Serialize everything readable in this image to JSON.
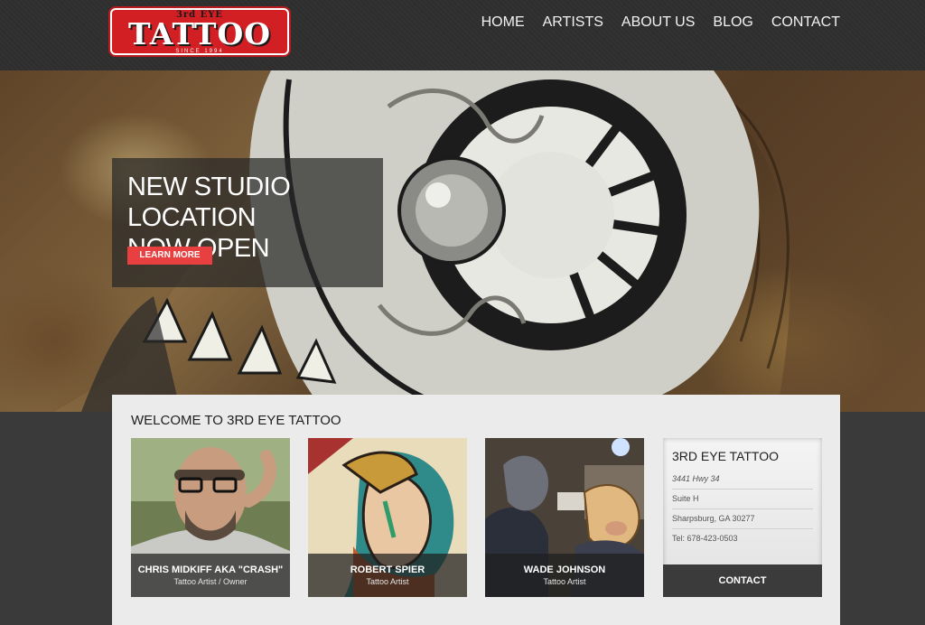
{
  "logo": {
    "top": "3rd EYE",
    "main": "TATTOO",
    "since": "SINCE 1994"
  },
  "nav": {
    "items": [
      {
        "label": "HOME"
      },
      {
        "label": "ARTISTS"
      },
      {
        "label": "ABOUT US"
      },
      {
        "label": "BLOG"
      },
      {
        "label": "CONTACT"
      }
    ]
  },
  "hero": {
    "title_line1": "NEW STUDIO LOCATION",
    "title_line2": "NOW OPEN",
    "button": "LEARN MORE"
  },
  "welcome": {
    "heading": "WELCOME TO 3RD EYE TATTOO"
  },
  "artists": [
    {
      "name": "CHRIS MIDKIFF AKA \"CRASH\"",
      "role": "Tattoo Artist / Owner"
    },
    {
      "name": "ROBERT SPIER",
      "role": "Tattoo Artist"
    },
    {
      "name": "WADE JOHNSON",
      "role": "Tattoo Artist"
    }
  ],
  "contact": {
    "title": "3RD EYE TATTOO",
    "address": "3441 Hwy 34",
    "suite": "Suite H",
    "city": "Sharpsburg, GA 30277",
    "phone": "Tel: 678-423-0503",
    "button": "CONTACT"
  },
  "colors": {
    "accent": "#e84040",
    "logo_red": "#d21f23",
    "header_bg": "#2e2e2e"
  }
}
